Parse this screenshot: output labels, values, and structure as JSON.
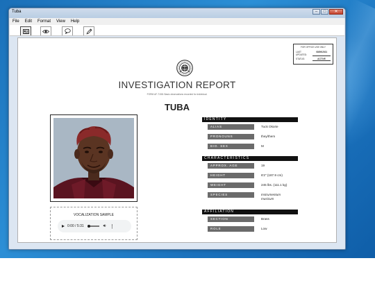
{
  "window": {
    "title": "Tuba",
    "controls": {
      "minimize": "–",
      "maximize": "□",
      "close": "✕"
    }
  },
  "menu": [
    "File",
    "Edit",
    "Format",
    "View",
    "Help"
  ],
  "toolbar": {
    "icons": [
      "id-card-icon",
      "eye-icon",
      "speech-bubble-icon",
      "pen-icon"
    ],
    "active_index": 0
  },
  "office_box": {
    "title": "FOR OFFICE USE ONLY",
    "last_updated_label": "LAST UPDATED:",
    "last_updated_value": "08/09/2021",
    "status_label": "STATUS:",
    "status_value": "ACTIVE"
  },
  "report": {
    "title": "INVESTIGATION REPORT",
    "form_line": "FORM AF-7158: Basic observations recorded for individual.",
    "subject": "TUBA"
  },
  "audio": {
    "label": "VOCALIZATION SAMPLE",
    "time": "0:00 / 5:31"
  },
  "identity": {
    "header": "IDENTITY",
    "rows": [
      {
        "label": "ALIAS",
        "value": "Tuck Okorie"
      },
      {
        "label": "PRONOUNS",
        "value": "they/them"
      },
      {
        "label": "BIO. SEX",
        "value": "M"
      }
    ]
  },
  "characteristics": {
    "header": "CHARACTERISTICS",
    "rows": [
      {
        "label": "APPROX. AGE",
        "value": "19"
      },
      {
        "label": "HEIGHT",
        "value": "6'2\" (187.9 cm)"
      },
      {
        "label": "WEIGHT",
        "value": "245 lbs. (111.1 kg)"
      },
      {
        "label": "SPECIES",
        "value": "Instrumentum musicum"
      }
    ]
  },
  "affiliation": {
    "header": "AFFILIATION",
    "rows": [
      {
        "label": "SECTION",
        "value": "Brass"
      },
      {
        "label": "ROLE",
        "value": "Low"
      }
    ]
  },
  "colors": {
    "desktop": "#1b72bd",
    "section_header": "#111111",
    "label_bg": "#6b6b6b",
    "status_active": "#000000"
  }
}
